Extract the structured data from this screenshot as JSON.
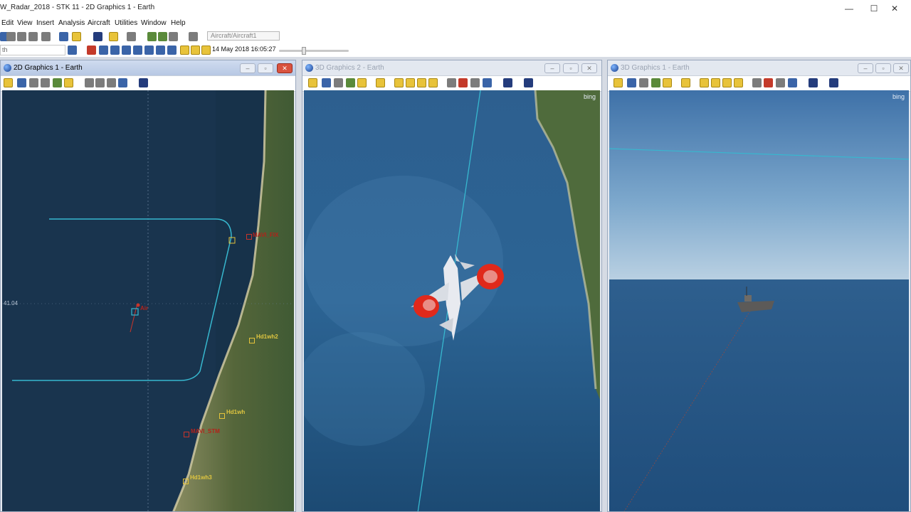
{
  "app": {
    "title": "W_Radar_2018 - STK 11 - 2D Graphics 1 - Earth",
    "window_controls": [
      "—",
      "☐",
      "✕"
    ]
  },
  "menu": [
    "Edit",
    "View",
    "Insert",
    "Analysis",
    "Aircraft",
    "Utilities",
    "Window",
    "Help"
  ],
  "toolbar": {
    "object_selector": "Aircraft/Aircraft1",
    "search_text": "th"
  },
  "animation": {
    "time": "14 May 2018 16:05:27"
  },
  "windows": [
    {
      "title": "2D Graphics 1 - Earth",
      "active": true,
      "map_labels": {
        "left_edge": "41.04",
        "aircraft": "Air",
        "facility_1": "MAVI_FIX",
        "facility_2": "MAVI_STM",
        "gold_1": "Hd1wh2",
        "gold_2": "Hd1wh",
        "gold_3": "Hd1wh3"
      }
    },
    {
      "title": "3D Graphics 2 - Earth",
      "active": false,
      "brand": "bing"
    },
    {
      "title": "3D Graphics 1 - Earth",
      "active": false,
      "brand": "bing"
    }
  ],
  "colors": {
    "track_cyan": "#37b8cf",
    "facility_red": "#c8352a",
    "facility_gold": "#e5c33a",
    "ocean": "#1f4f7c"
  }
}
